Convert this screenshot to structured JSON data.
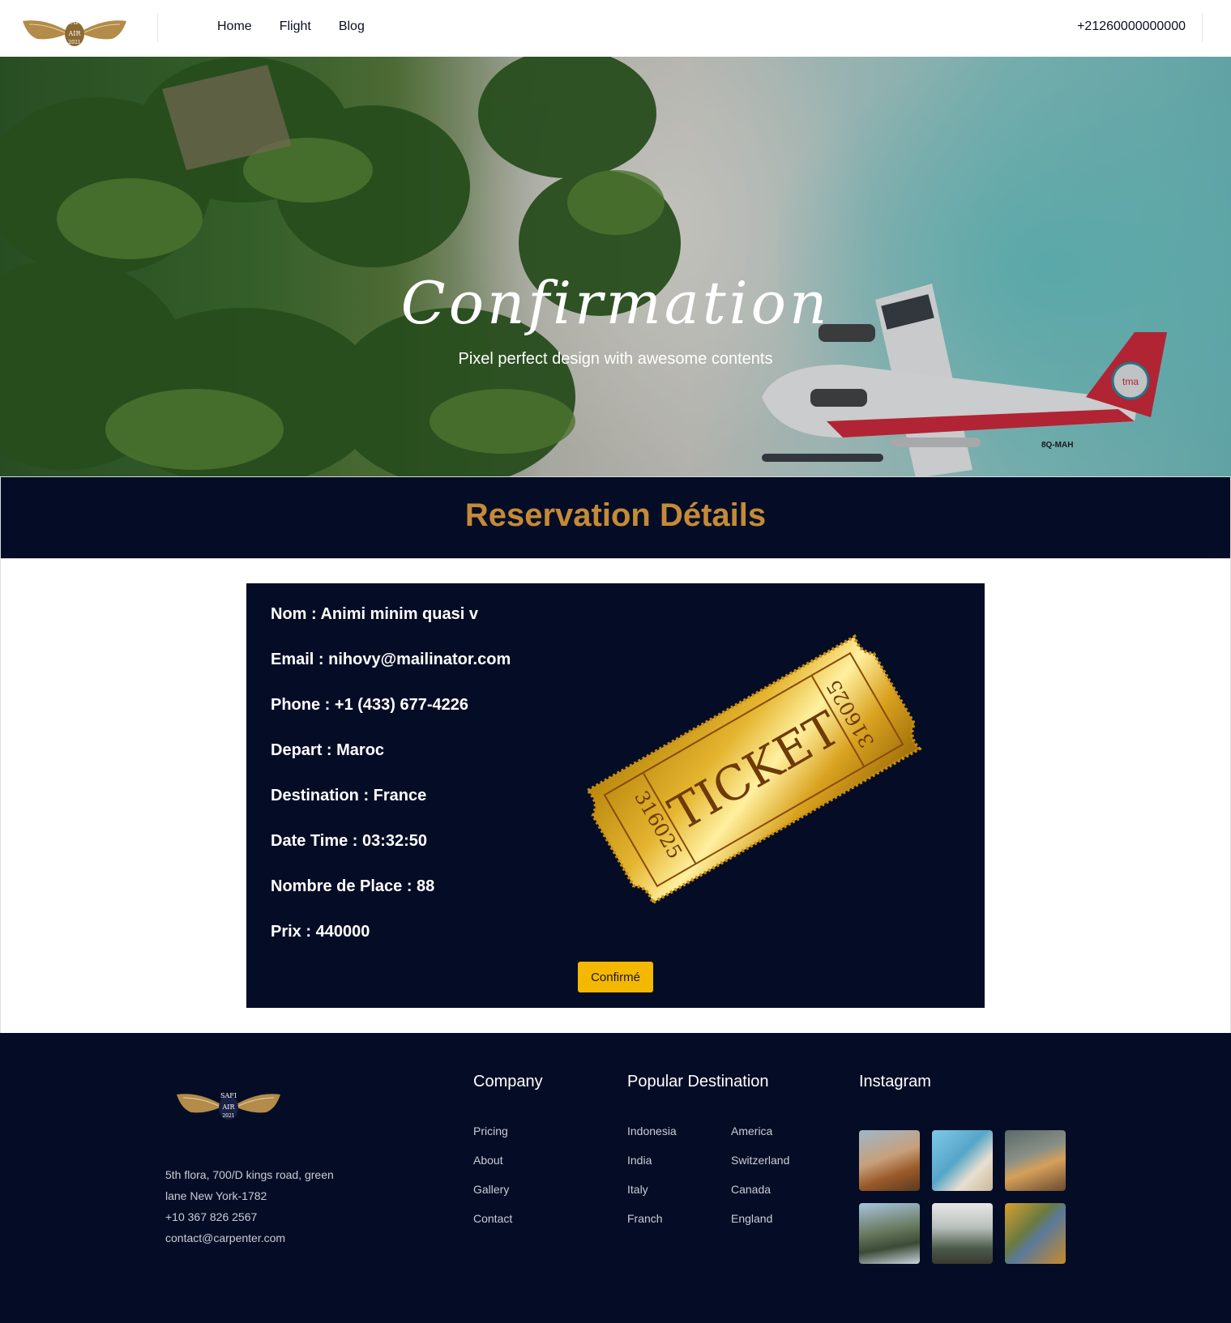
{
  "header": {
    "logo_text": "SAFI AIR 2021",
    "nav": [
      "Home",
      "Flight",
      "Blog"
    ],
    "phone": "+21260000000000"
  },
  "hero": {
    "title": "Confirmation",
    "subtitle": "Pixel perfect design with awesome contents",
    "plane_registration": "8Q-MAH",
    "plane_logo": "tma"
  },
  "reservation": {
    "heading": "Reservation Détails",
    "details": [
      "Nom : Animi minim quasi v",
      "Email : nihovy@mailinator.com",
      "Phone : +1 (433) 677-4226",
      "Depart : Maroc",
      "Destination : France",
      "Date Time : 03:32:50",
      "Nombre de Place : 88",
      "Prix : 440000"
    ],
    "ticket": {
      "label": "TICKET",
      "number": "316025"
    },
    "confirm_button": "Confirmé"
  },
  "footer": {
    "address_lines": [
      "5th flora, 700/D kings road, green",
      "lane New York-1782",
      "+10 367 826 2567",
      "contact@carpenter.com"
    ],
    "company": {
      "title": "Company",
      "items": [
        "Pricing",
        "About",
        "Gallery",
        "Contact"
      ]
    },
    "popular": {
      "title": "Popular Destination",
      "col1": [
        "Indonesia",
        "India",
        "Italy",
        "Franch"
      ],
      "col2": [
        "America",
        "Switzerland",
        "Canada",
        "England"
      ]
    },
    "instagram": {
      "title": "Instagram"
    }
  },
  "colors": {
    "navy": "#050d26",
    "gold_heading": "#c58a37",
    "button": "#f5b800"
  }
}
